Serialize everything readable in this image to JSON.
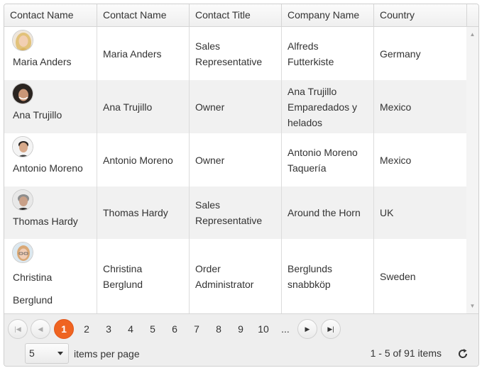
{
  "columns": [
    "Contact Name",
    "Contact Name",
    "Contact Title",
    "Company Name",
    "Country"
  ],
  "rows": [
    {
      "photo_name": "Maria Anders",
      "contact_name": "Maria Anders",
      "contact_title": [
        "Sales",
        "Representative"
      ],
      "company": [
        "Alfreds",
        "Futterkiste"
      ],
      "country": "Germany",
      "avatar_icon": "avatar-blonde-woman-icon"
    },
    {
      "photo_name": "Ana Trujillo",
      "contact_name": "Ana Trujillo",
      "contact_title": [
        "Owner"
      ],
      "company": [
        "Ana Trujillo",
        "Emparedados y",
        "helados"
      ],
      "country": "Mexico",
      "avatar_icon": "avatar-dark-hair-woman-icon"
    },
    {
      "photo_name": "Antonio Moreno",
      "contact_name": "Antonio Moreno",
      "contact_title": [
        "Owner"
      ],
      "company": [
        "Antonio Moreno",
        "Taquería"
      ],
      "country": "Mexico",
      "avatar_icon": "avatar-man-icon"
    },
    {
      "photo_name": "Thomas Hardy",
      "contact_name": "Thomas Hardy",
      "contact_title": [
        "Sales",
        "Representative"
      ],
      "company": [
        "Around the Horn"
      ],
      "country": "UK",
      "avatar_icon": "avatar-grey-hair-man-icon"
    },
    {
      "photo_name": [
        "Christina",
        "Berglund"
      ],
      "contact_name": [
        "Christina",
        "Berglund"
      ],
      "contact_title": [
        "Order",
        "Administrator"
      ],
      "company": [
        "Berglunds",
        "snabbköp"
      ],
      "country": "Sweden",
      "avatar_icon": "avatar-glasses-woman-icon"
    }
  ],
  "pager": {
    "first_icon": "first-page-icon",
    "prev_icon": "prev-page-icon",
    "next_icon": "next-page-icon",
    "last_icon": "last-page-icon",
    "pages": [
      "1",
      "2",
      "3",
      "4",
      "5",
      "6",
      "7",
      "8",
      "9",
      "10",
      "..."
    ],
    "current_page": "1",
    "page_size": "5",
    "items_per_page_label": "items per page",
    "info": "1 - 5 of 91 items",
    "refresh_icon": "refresh-icon",
    "accent_color": "#ef6421"
  },
  "scrollbar": {
    "up_icon": "scroll-up-arrow-icon",
    "down_icon": "scroll-down-arrow-icon"
  }
}
